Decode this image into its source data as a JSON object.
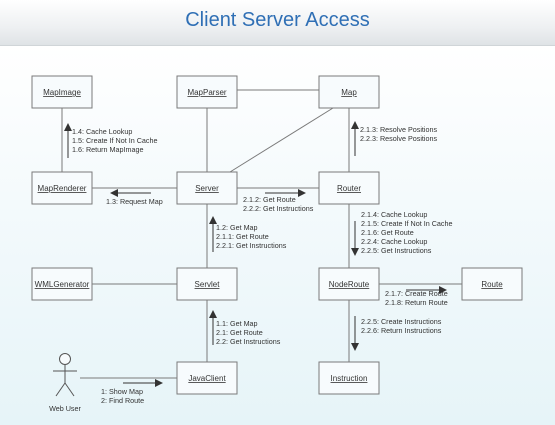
{
  "title": "Client Server Access",
  "objects": {
    "mapimage": "MapImage",
    "mapparser": "MapParser",
    "map": "Map",
    "maprenderer": "MapRenderer",
    "server": "Server",
    "router": "Router",
    "wmlgenerator": "WMLGenerator",
    "servlet": "Servlet",
    "noderoute": "NodeRoute",
    "route": "Route",
    "javaclient": "JavaClient",
    "instruction": "Instruction"
  },
  "actor": "Web User",
  "messages": {
    "renderer_to_image": [
      "1.4: Cache Lookup",
      "1.5: Create If Not In Cache",
      "1.6: Return MapImage"
    ],
    "router_to_map": [
      "2.1.3: Resolve Positions",
      "2.2.3: Resolve Positions"
    ],
    "server_to_renderer": [
      "1.3: Request Map"
    ],
    "server_to_router": [
      "2.1.2: Get Route",
      "2.2.2: Get Instructions"
    ],
    "servlet_to_server": [
      "1.2: Get Map",
      "2.1.1: Get Route",
      "2.2.1: Get Instructions"
    ],
    "router_to_noderoute": [
      "2.1.4: Cache Lookup",
      "2.1.5: Create If Not In Cache",
      "2.1.6: Get Route",
      "2.2.4: Cache Lookup",
      "2.2.5: Get Instructions"
    ],
    "noderoute_to_route": [
      "2.1.7: Create Route",
      "2.1.8: Return Route"
    ],
    "noderoute_to_instruction": [
      "2.2.5: Create Instructions",
      "2.2.6: Return Instructions"
    ],
    "javaclient_to_servlet": [
      "1.1: Get Map",
      "2.1: Get Route",
      "2.2: Get Instructions"
    ],
    "user_to_javaclient": [
      "1: Show Map",
      "2: Find Route"
    ]
  }
}
